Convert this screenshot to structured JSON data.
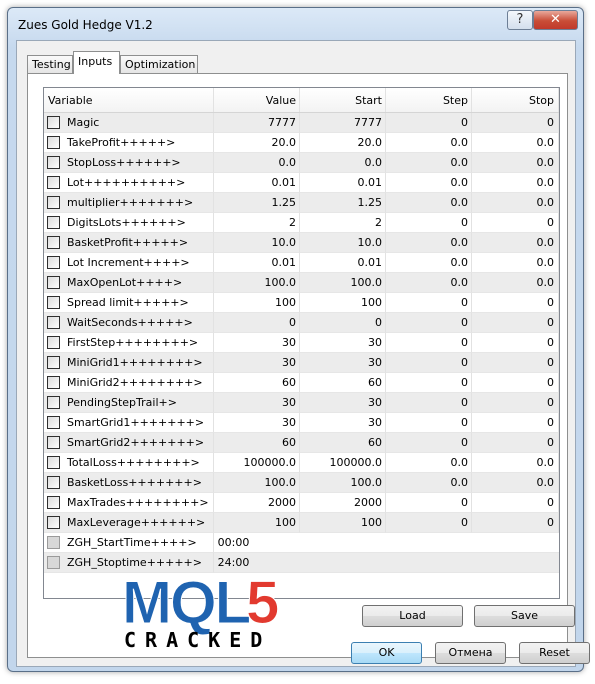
{
  "window": {
    "title": "Zues Gold Hedge V1.2",
    "help_label": "?",
    "close_label": "✕"
  },
  "tabs": [
    {
      "label": "Testing",
      "active": false
    },
    {
      "label": "Inputs",
      "active": true
    },
    {
      "label": "Optimization",
      "active": false
    }
  ],
  "columns": [
    "Variable",
    "Value",
    "Start",
    "Step",
    "Stop"
  ],
  "rows": [
    {
      "variable": "Magic",
      "value": "7777",
      "start": "7777",
      "step": "0",
      "stop": "0"
    },
    {
      "variable": "TakeProfit+++++>",
      "value": "20.0",
      "start": "20.0",
      "step": "0.0",
      "stop": "0.0"
    },
    {
      "variable": "StopLoss++++++>",
      "value": "0.0",
      "start": "0.0",
      "step": "0.0",
      "stop": "0.0"
    },
    {
      "variable": "Lot++++++++++>",
      "value": "0.01",
      "start": "0.01",
      "step": "0.0",
      "stop": "0.0"
    },
    {
      "variable": "multiplier+++++++>",
      "value": "1.25",
      "start": "1.25",
      "step": "0.0",
      "stop": "0.0"
    },
    {
      "variable": "DigitsLots++++++>",
      "value": "2",
      "start": "2",
      "step": "0",
      "stop": "0"
    },
    {
      "variable": "BasketProfit+++++>",
      "value": "10.0",
      "start": "10.0",
      "step": "0.0",
      "stop": "0.0"
    },
    {
      "variable": "Lot Increment++++>",
      "value": "0.01",
      "start": "0.01",
      "step": "0.0",
      "stop": "0.0"
    },
    {
      "variable": "MaxOpenLot++++>",
      "value": "100.0",
      "start": "100.0",
      "step": "0.0",
      "stop": "0.0"
    },
    {
      "variable": "Spread limit+++++>",
      "value": "100",
      "start": "100",
      "step": "0",
      "stop": "0"
    },
    {
      "variable": "WaitSeconds+++++>",
      "value": "0",
      "start": "0",
      "step": "0",
      "stop": "0"
    },
    {
      "variable": "FirstStep++++++++>",
      "value": "30",
      "start": "30",
      "step": "0",
      "stop": "0"
    },
    {
      "variable": "MiniGrid1++++++++>",
      "value": "30",
      "start": "30",
      "step": "0",
      "stop": "0"
    },
    {
      "variable": "MiniGrid2++++++++>",
      "value": "60",
      "start": "60",
      "step": "0",
      "stop": "0"
    },
    {
      "variable": "PendingStepTrail+>",
      "value": "30",
      "start": "30",
      "step": "0",
      "stop": "0"
    },
    {
      "variable": "SmartGrid1+++++++>",
      "value": "30",
      "start": "30",
      "step": "0",
      "stop": "0"
    },
    {
      "variable": "SmartGrid2+++++++>",
      "value": "60",
      "start": "60",
      "step": "0",
      "stop": "0"
    },
    {
      "variable": "TotalLoss++++++++>",
      "value": "100000.0",
      "start": "100000.0",
      "step": "0.0",
      "stop": "0.0"
    },
    {
      "variable": "BasketLoss+++++++>",
      "value": "100.0",
      "start": "100.0",
      "step": "0.0",
      "stop": "0.0"
    },
    {
      "variable": "MaxTrades++++++++>",
      "value": "2000",
      "start": "2000",
      "step": "0",
      "stop": "0"
    },
    {
      "variable": "MaxLeverage++++++>",
      "value": "100",
      "start": "100",
      "step": "0",
      "stop": "0"
    }
  ],
  "text_rows": [
    {
      "variable": "ZGH_StartTime++++>",
      "value": "00:00"
    },
    {
      "variable": "ZGH_Stoptime+++++>",
      "value": "24:00"
    }
  ],
  "buttons": {
    "load": "Load",
    "save": "Save",
    "ok": "OK",
    "cancel": "Отмена",
    "reset": "Reset"
  },
  "watermark": {
    "logo_text": "MQL5",
    "subtitle": "CRACKED",
    "colors": {
      "blue": "#1f63b0",
      "red": "#e23a2f"
    }
  }
}
